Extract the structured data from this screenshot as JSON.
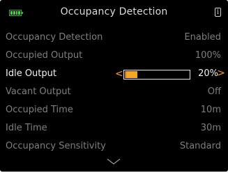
{
  "header": {
    "title": "Occupancy Detection",
    "battery_icon": "battery-icon",
    "info_icon": "info-icon",
    "info_glyph": "i"
  },
  "rows": [
    {
      "label": "Occupancy Detection",
      "value": "Enabled"
    },
    {
      "label": "Occupied Output",
      "value": "100%"
    },
    {
      "label": "Idle Output",
      "value": "20%",
      "level": 0.2
    },
    {
      "label": "Vacant Output",
      "value": "Off"
    },
    {
      "label": "Occupied Time",
      "value": "10m"
    },
    {
      "label": "Idle Time",
      "value": "30m"
    },
    {
      "label": "Occupancy Sensitivity",
      "value": "Standard"
    }
  ],
  "controls": {
    "decrease_glyph": "<",
    "increase_glyph": ">"
  },
  "colors": {
    "accent": "#f2a824",
    "battery": "#3fd43f",
    "active_text": "#f2f2f2",
    "inactive_text": "#7f7f7f",
    "background": "#000000"
  },
  "scroll_indicator": "chevron-down-icon"
}
